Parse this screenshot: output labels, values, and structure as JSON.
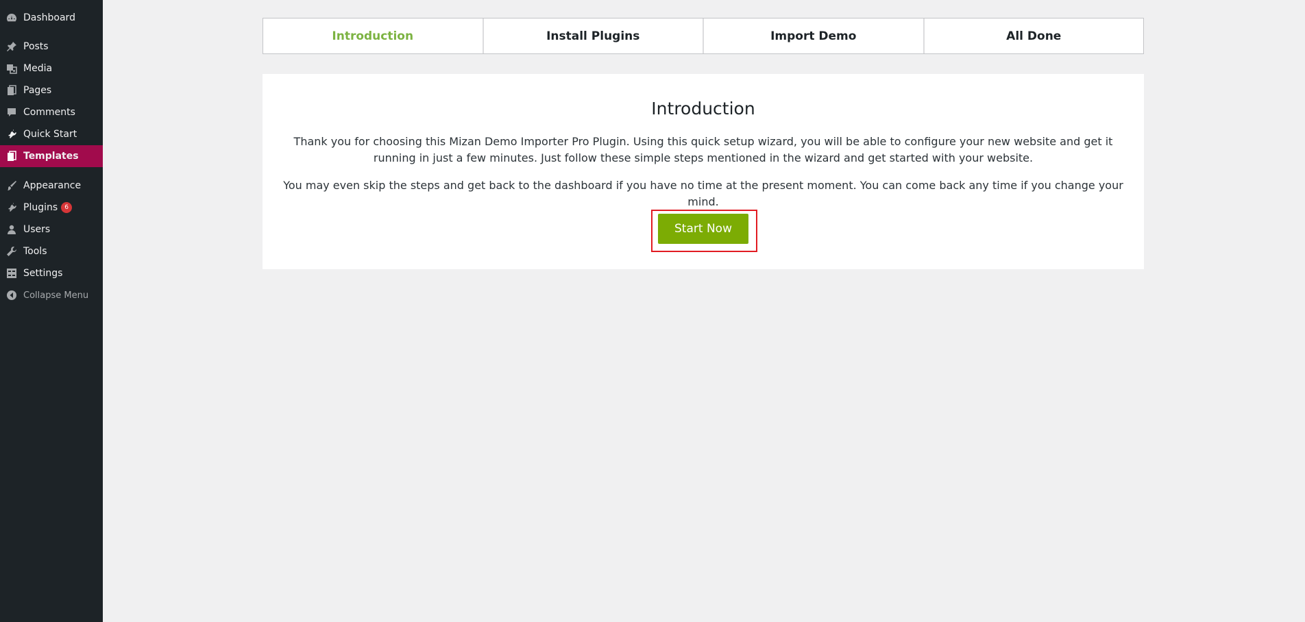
{
  "sidebar": {
    "items": [
      {
        "label": "Dashboard",
        "icon": "dashboard-icon"
      },
      {
        "label": "Posts",
        "icon": "pin-icon"
      },
      {
        "label": "Media",
        "icon": "media-icon"
      },
      {
        "label": "Pages",
        "icon": "pages-icon"
      },
      {
        "label": "Comments",
        "icon": "comment-icon"
      },
      {
        "label": "Quick Start",
        "icon": "plugin-icon"
      },
      {
        "label": "Templates",
        "icon": "pages-icon",
        "active": true
      },
      {
        "label": "Appearance",
        "icon": "brush-icon"
      },
      {
        "label": "Plugins",
        "icon": "plugin-icon",
        "badge": "6"
      },
      {
        "label": "Users",
        "icon": "user-icon"
      },
      {
        "label": "Tools",
        "icon": "wrench-icon"
      },
      {
        "label": "Settings",
        "icon": "settings-icon"
      },
      {
        "label": "Collapse Menu",
        "icon": "collapse-icon"
      }
    ],
    "active_color": "#a10b4c",
    "background_color": "#1d2327"
  },
  "wizard": {
    "steps": [
      {
        "label": "Introduction",
        "current": true
      },
      {
        "label": "Install Plugins"
      },
      {
        "label": "Import Demo"
      },
      {
        "label": "All Done"
      }
    ],
    "current_step_color": "#7cb342"
  },
  "content": {
    "title": "Introduction",
    "paragraph1": "Thank you for choosing this Mizan Demo Importer Pro Plugin. Using this quick setup wizard, you will be able to configure your new website and get it running in just a few minutes. Just follow these simple steps mentioned in the wizard and get started with your website.",
    "paragraph2": "You may even skip the steps and get back to the dashboard if you have no time at the present moment. You can come back any time if you change your mind.",
    "start_button_label": "Start Now",
    "button_color": "#7cac04",
    "highlight_color": "#e11b22"
  }
}
